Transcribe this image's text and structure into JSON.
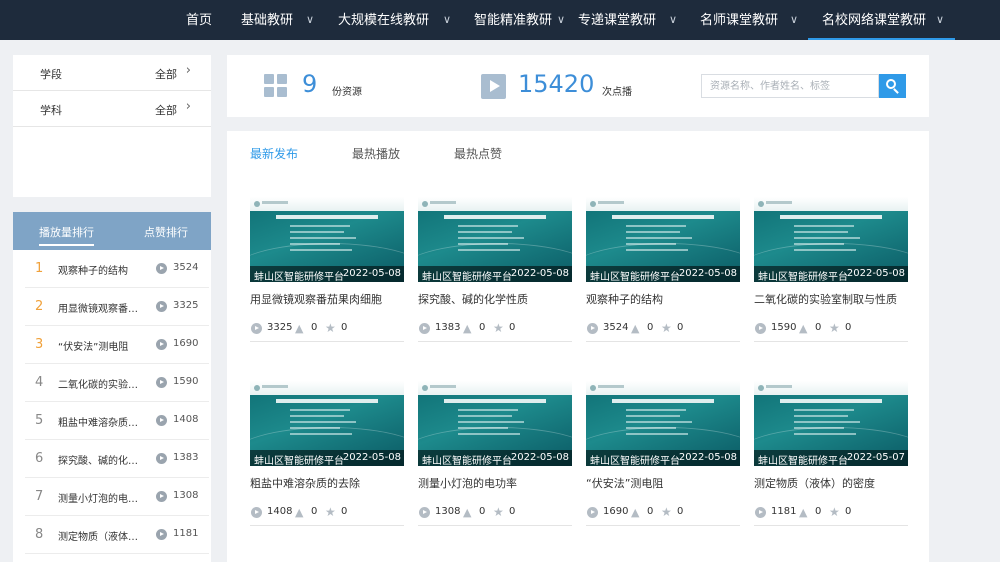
{
  "nav": {
    "items": [
      {
        "label": "首页",
        "dropdown": false,
        "active": false
      },
      {
        "label": "基础教研",
        "dropdown": true,
        "active": false
      },
      {
        "label": "大规模在线教研",
        "dropdown": true,
        "active": false
      },
      {
        "label": "智能精准教研",
        "dropdown": true,
        "active": false
      },
      {
        "label": "专递课堂教研",
        "dropdown": true,
        "active": false
      },
      {
        "label": "名师课堂教研",
        "dropdown": true,
        "active": false
      },
      {
        "label": "名校网络课堂教研",
        "dropdown": true,
        "active": true
      }
    ]
  },
  "filters": [
    {
      "label": "学段",
      "value": "全部"
    },
    {
      "label": "学科",
      "value": "全部"
    }
  ],
  "ranking": {
    "tabs": [
      "播放量排行",
      "点赞排行"
    ],
    "items": [
      {
        "rank": "1",
        "title": "观察种子的结构",
        "count": "3524"
      },
      {
        "rank": "2",
        "title": "用显微镜观察番茄果肉细胞",
        "count": "3325"
      },
      {
        "rank": "3",
        "title": "“伏安法”测电阻",
        "count": "1690"
      },
      {
        "rank": "4",
        "title": "二氧化碳的实验室制取与性质",
        "count": "1590"
      },
      {
        "rank": "5",
        "title": "粗盐中难溶杂质的去除",
        "count": "1408"
      },
      {
        "rank": "6",
        "title": "探究酸、碱的化学性质",
        "count": "1383"
      },
      {
        "rank": "7",
        "title": "测量小灯泡的电功率",
        "count": "1308"
      },
      {
        "rank": "8",
        "title": "测定物质（液体）的密度",
        "count": "1181"
      }
    ]
  },
  "stats": {
    "resources_count": "9",
    "resources_unit": "份资源",
    "plays_count": "15420",
    "plays_unit": "次点播"
  },
  "search": {
    "placeholder": "资源名称、作者姓名、标签"
  },
  "content_tabs": [
    "最新发布",
    "最热播放",
    "最热点赞"
  ],
  "resources": [
    {
      "org": "蚌山区智能研修平台",
      "date": "2022-05-08",
      "title": "用显微镜观察番茄果肉细胞",
      "plays": "3325",
      "likes": "0",
      "stars": "0"
    },
    {
      "org": "蚌山区智能研修平台",
      "date": "2022-05-08",
      "title": "探究酸、碱的化学性质",
      "plays": "1383",
      "likes": "0",
      "stars": "0"
    },
    {
      "org": "蚌山区智能研修平台",
      "date": "2022-05-08",
      "title": "观察种子的结构",
      "plays": "3524",
      "likes": "0",
      "stars": "0"
    },
    {
      "org": "蚌山区智能研修平台",
      "date": "2022-05-08",
      "title": "二氧化碳的实验室制取与性质",
      "plays": "1590",
      "likes": "0",
      "stars": "0"
    },
    {
      "org": "蚌山区智能研修平台",
      "date": "2022-05-08",
      "title": "粗盐中难溶杂质的去除",
      "plays": "1408",
      "likes": "0",
      "stars": "0"
    },
    {
      "org": "蚌山区智能研修平台",
      "date": "2022-05-08",
      "title": "测量小灯泡的电功率",
      "plays": "1308",
      "likes": "0",
      "stars": "0"
    },
    {
      "org": "蚌山区智能研修平台",
      "date": "2022-05-08",
      "title": "“伏安法”测电阻",
      "plays": "1690",
      "likes": "0",
      "stars": "0"
    },
    {
      "org": "蚌山区智能研修平台",
      "date": "2022-05-07",
      "title": "测定物质（液体）的密度",
      "plays": "1181",
      "likes": "0",
      "stars": "0"
    }
  ],
  "colors": {
    "nav_bg": "#1e2b3c",
    "accent": "#2f9ae8",
    "rank_header": "#7fa4c6",
    "top_rank": "#f0a13a",
    "thumb_teal": "#1d8a8c"
  }
}
